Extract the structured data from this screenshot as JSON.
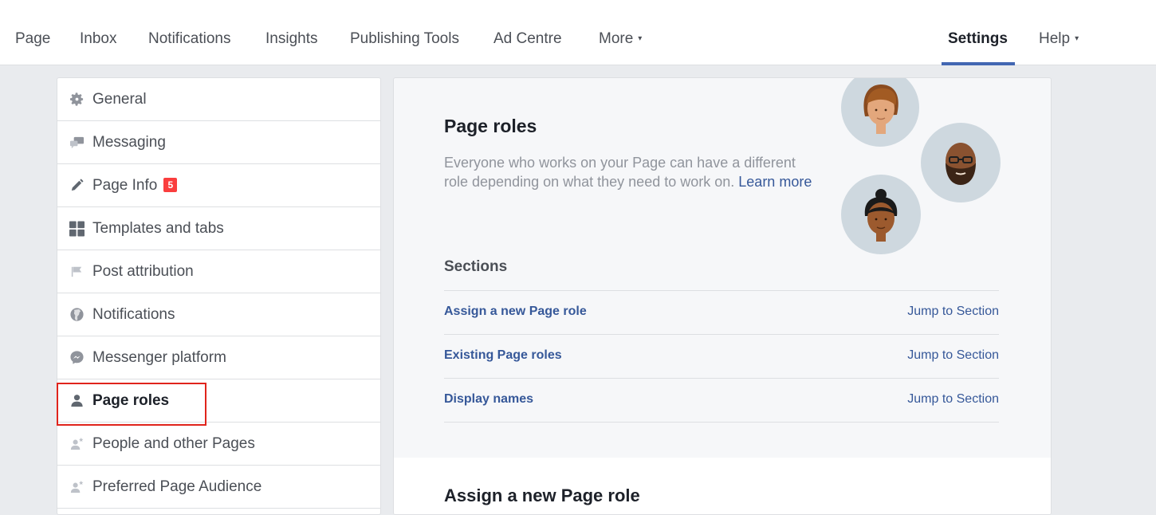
{
  "topnav": {
    "items": [
      {
        "label": "Page"
      },
      {
        "label": "Inbox"
      },
      {
        "label": "Notifications"
      },
      {
        "label": "Insights"
      },
      {
        "label": "Publishing Tools"
      },
      {
        "label": "Ad Centre"
      },
      {
        "label": "More",
        "caret": "▾"
      }
    ],
    "settings_label": "Settings",
    "help_label": "Help",
    "help_caret": "▾"
  },
  "sidebar": {
    "items": [
      {
        "label": "General",
        "icon": "gear-icon"
      },
      {
        "label": "Messaging",
        "icon": "chat-bubbles-icon"
      },
      {
        "label": "Page Info",
        "icon": "pencil-icon",
        "badge": "5"
      },
      {
        "label": "Templates and tabs",
        "icon": "grid-icon"
      },
      {
        "label": "Post attribution",
        "icon": "flag-icon"
      },
      {
        "label": "Notifications",
        "icon": "globe-icon"
      },
      {
        "label": "Messenger platform",
        "icon": "messenger-icon"
      },
      {
        "label": "Page roles",
        "icon": "person-icon",
        "selected": true
      },
      {
        "label": "People and other Pages",
        "icon": "person-star-icon"
      },
      {
        "label": "Preferred Page Audience",
        "icon": "person-star-icon"
      }
    ]
  },
  "main": {
    "title": "Page roles",
    "description": "Everyone who works on your Page can have a different role depending on what they need to work on.",
    "learn_more": "Learn more",
    "sections_title": "Sections",
    "sections": [
      {
        "name": "Assign a new Page role",
        "jump": "Jump to Section"
      },
      {
        "name": "Existing Page roles",
        "jump": "Jump to Section"
      },
      {
        "name": "Display names",
        "jump": "Jump to Section"
      }
    ],
    "assign_title": "Assign a new Page role"
  },
  "colors": {
    "accent": "#4267b2",
    "link": "#365899",
    "badge": "#fa3e3e",
    "highlight": "#e0241c"
  }
}
